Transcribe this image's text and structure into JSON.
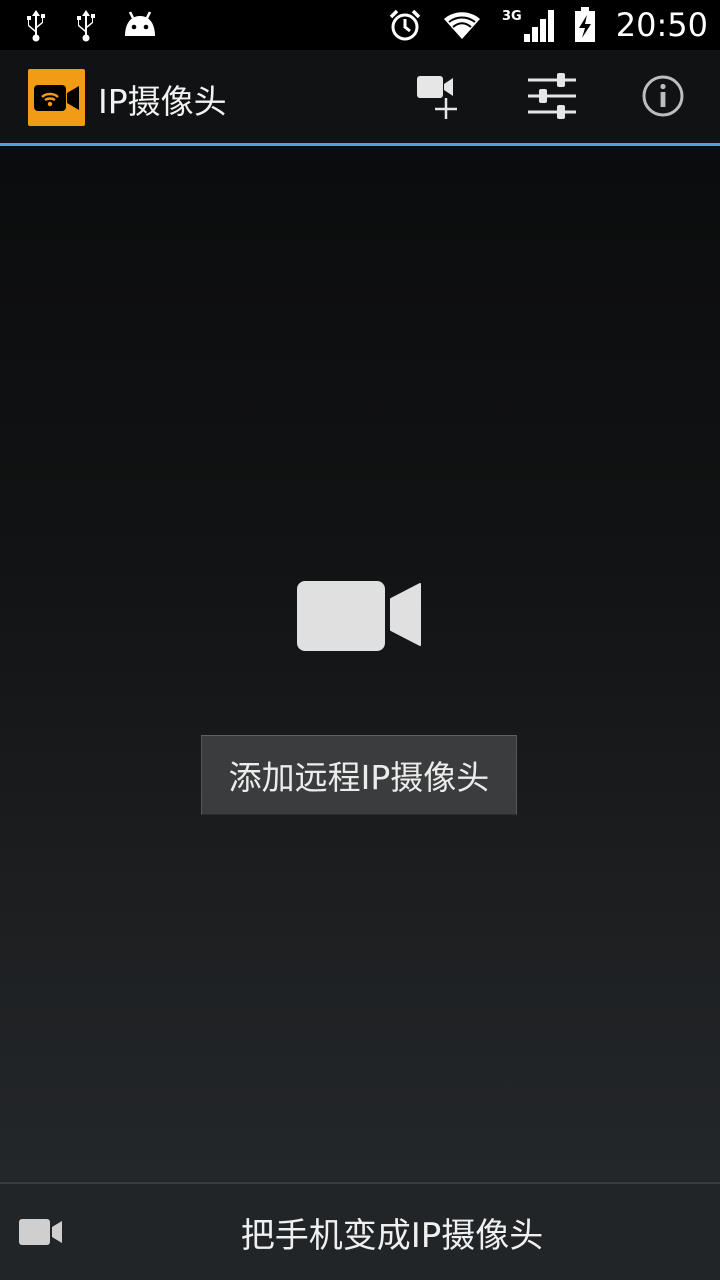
{
  "status_bar": {
    "time": "20:50",
    "network": "3G",
    "icons_left": [
      "usb-icon",
      "usb-icon",
      "android-icon"
    ],
    "icons_right": [
      "alarm-icon",
      "wifi-icon",
      "signal-3g-icon",
      "battery-charging-icon"
    ]
  },
  "action_bar": {
    "title": "IP摄像头",
    "actions": [
      "add-camera-icon",
      "sliders-icon",
      "info-icon"
    ],
    "accent_color": "#4aa3df",
    "app_icon_color": "#f29b14"
  },
  "main": {
    "center_icon": "video-camera-icon",
    "add_remote_button_label": "添加远程IP摄像头"
  },
  "bottom_bar": {
    "icon": "video-camera-icon",
    "label": "把手机变成IP摄像头"
  }
}
